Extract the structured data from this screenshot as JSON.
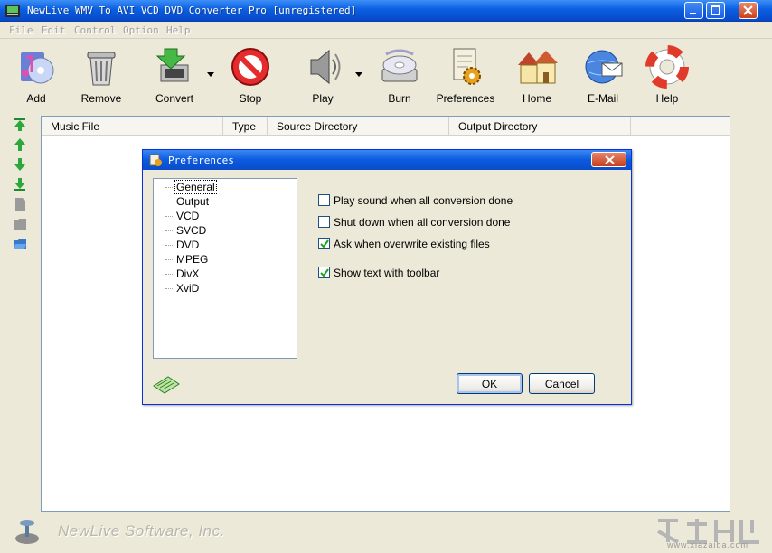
{
  "window": {
    "title": "NewLive WMV To AVI VCD DVD Converter Pro  [unregistered]"
  },
  "menu": [
    "File",
    "Edit",
    "Control",
    "Option",
    "Help"
  ],
  "toolbar": {
    "buttons": [
      {
        "label": "Add",
        "icon": "add-music-icon"
      },
      {
        "label": "Remove",
        "icon": "trash-can-icon"
      },
      {
        "label": "Convert",
        "icon": "convert-arrow-icon"
      },
      {
        "label": "Stop",
        "icon": "stop-sign-icon"
      },
      {
        "label": "Play",
        "icon": "speaker-icon"
      },
      {
        "label": "Burn",
        "icon": "disc-burn-icon"
      },
      {
        "label": "Preferences",
        "icon": "preferences-gear-icon"
      },
      {
        "label": "Home",
        "icon": "home-icon"
      },
      {
        "label": "E-Mail",
        "icon": "email-globe-icon"
      },
      {
        "label": "Help",
        "icon": "lifebuoy-icon"
      }
    ]
  },
  "file_list": {
    "columns": [
      "Music File",
      "Type",
      "Source Directory",
      "Output Directory"
    ]
  },
  "footer": {
    "brand": "NewLive Software, Inc.",
    "watermark_url": "www.xiazaiba.com"
  },
  "preferences_dialog": {
    "title": "Preferences",
    "tree": [
      "General",
      "Output",
      "VCD",
      "SVCD",
      "DVD",
      "MPEG",
      "DivX",
      "XviD"
    ],
    "selected_tree_item": "General",
    "options": [
      {
        "label": "Play sound when all conversion done",
        "checked": false
      },
      {
        "label": "Shut down when all conversion done",
        "checked": false
      },
      {
        "label": "Ask when overwrite existing files",
        "checked": true
      },
      {
        "label": "Show text with toolbar",
        "checked": true
      }
    ],
    "ok_label": "OK",
    "cancel_label": "Cancel"
  },
  "colors": {
    "titlebar": "#0a5fe0",
    "face": "#ece9d8",
    "list_border": "#7f9db9"
  }
}
